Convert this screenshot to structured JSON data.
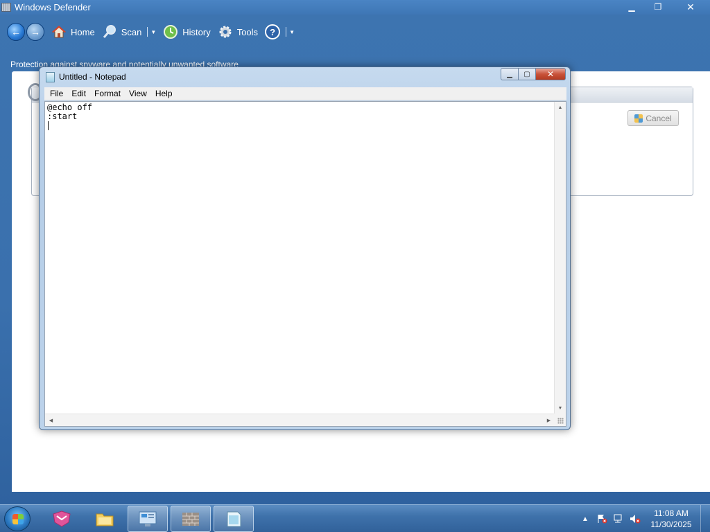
{
  "defender": {
    "title": "Windows Defender",
    "toolbar": {
      "home_label": "Home",
      "scan_label": "Scan",
      "history_label": "History",
      "tools_label": "Tools"
    },
    "subtitle": "Protection against spyware and potentially unwanted software",
    "cancel_label": "Cancel"
  },
  "notepad": {
    "title": "Untitled - Notepad",
    "menu": [
      "File",
      "Edit",
      "Format",
      "View",
      "Help"
    ],
    "content": "@echo off\n:start\n"
  },
  "taskbar": {
    "pinned": [
      "start-button",
      "app-pink-icon",
      "file-explorer-icon",
      "control-panel-icon",
      "firewall-icon",
      "notepad-icon"
    ],
    "active_item": "notepad-icon",
    "clock_time": "11:08 AM",
    "clock_date": "11/30/2025"
  },
  "colors": {
    "window_frame": "#3d74b0",
    "taskbar": "#3f72ab",
    "close_button": "#c8523a"
  }
}
